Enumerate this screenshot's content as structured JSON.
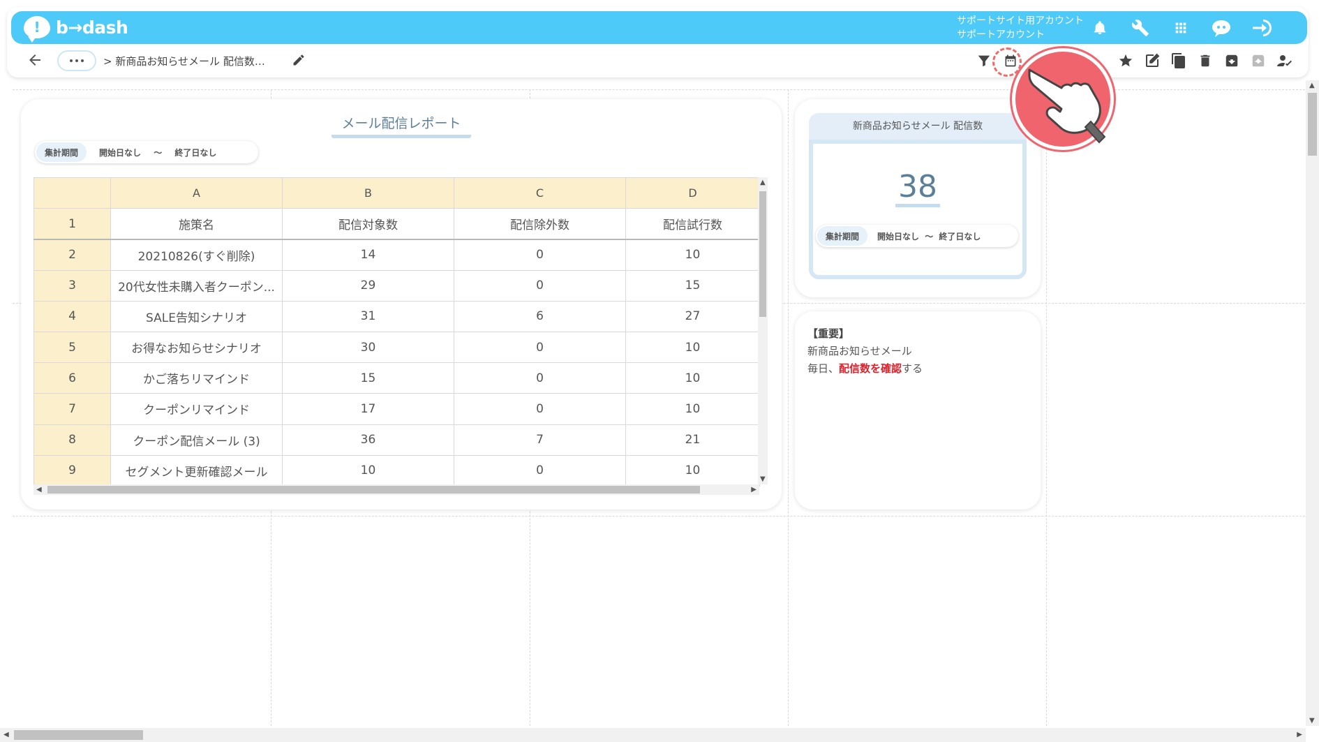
{
  "app": {
    "logo_mark": "!",
    "logo_text": "b→dash",
    "account_line1": "サポートサイト用アカウント",
    "account_line2": "サポートアカウント"
  },
  "header_icons": [
    "bell-icon",
    "wrench-icon",
    "grid-icon",
    "chat-bot-icon",
    "logout-icon"
  ],
  "breadcrumb": {
    "more_label": "···",
    "separator": ">",
    "current": "新商品お知らせメール 配信数…"
  },
  "toolbar_icons": [
    "filter-icon",
    "calendar-icon",
    "chevron-down-icon",
    "star-icon",
    "edit-icon",
    "copy-icon",
    "trash-icon",
    "archive-down-icon",
    "archive-up-icon",
    "user-check-icon"
  ],
  "report": {
    "title": "メール配信レポート",
    "period_label": "集計期間",
    "period_start": "開始日なし",
    "period_sep": "〜",
    "period_end": "終了日なし",
    "columns": [
      "",
      "A",
      "B",
      "C",
      "D"
    ],
    "header_row": {
      "num": "1",
      "cells": [
        "施策名",
        "配信対象数",
        "配信除外数",
        "配信試行数"
      ]
    },
    "rows": [
      {
        "num": "2",
        "cells": [
          "20210826(すぐ削除)",
          "14",
          "0",
          "10"
        ]
      },
      {
        "num": "3",
        "cells": [
          "20代女性未購入者クーポン...",
          "29",
          "0",
          "15"
        ]
      },
      {
        "num": "4",
        "cells": [
          "SALE告知シナリオ",
          "31",
          "6",
          "27"
        ]
      },
      {
        "num": "5",
        "cells": [
          "お得なお知らせシナリオ",
          "30",
          "0",
          "10"
        ]
      },
      {
        "num": "6",
        "cells": [
          "かご落ちリマインド",
          "15",
          "0",
          "10"
        ]
      },
      {
        "num": "7",
        "cells": [
          "クーポンリマインド",
          "17",
          "0",
          "10"
        ]
      },
      {
        "num": "8",
        "cells": [
          "クーポン配信メール (3)",
          "36",
          "7",
          "21"
        ]
      },
      {
        "num": "9",
        "cells": [
          "セグメント更新確認メール",
          "10",
          "0",
          "10"
        ]
      }
    ]
  },
  "kpi": {
    "title": "新商品お知らせメール 配信数",
    "value": "38",
    "period_label": "集計期間",
    "period_start": "開始日なし",
    "period_sep": "〜",
    "period_end": "終了日なし"
  },
  "note": {
    "heading": "【重要】",
    "line1": "新商品お知らせメール",
    "line2_prefix": "毎日、",
    "line2_highlight": "配信数を確認",
    "line2_suffix": "する"
  },
  "colors": {
    "brand": "#4dcaf7",
    "header_cell": "#fcf0cc",
    "highlight_text": "#e0202a",
    "pointer": "#f0646e"
  }
}
